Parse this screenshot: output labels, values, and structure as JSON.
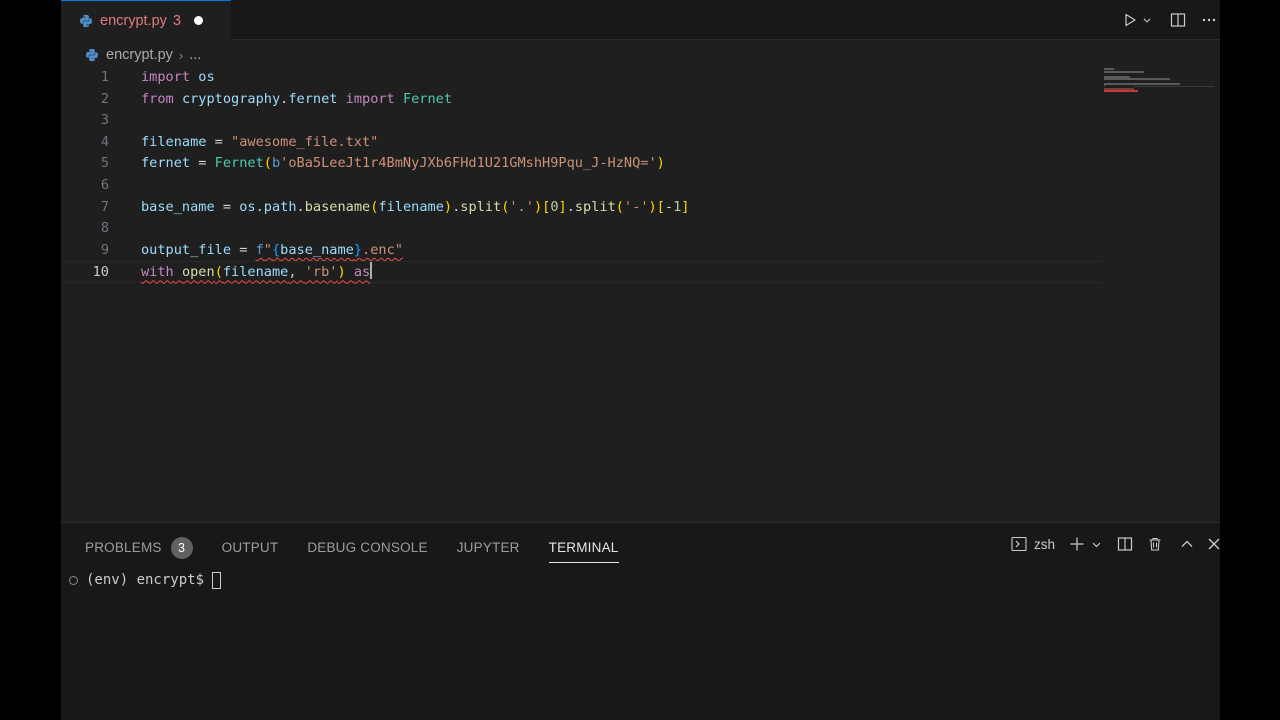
{
  "tab": {
    "filename": "encrypt.py",
    "problem_count": "3",
    "icon": "python-icon"
  },
  "breadcrumb": {
    "file": "encrypt.py",
    "separator": "›",
    "more": "..."
  },
  "editor": {
    "current_line": 10,
    "lines": [
      {
        "n": "1",
        "tokens": [
          [
            "kw",
            "import"
          ],
          [
            "op",
            " "
          ],
          [
            "id",
            "os"
          ]
        ]
      },
      {
        "n": "2",
        "tokens": [
          [
            "kw",
            "from"
          ],
          [
            "op",
            " "
          ],
          [
            "id",
            "cryptography"
          ],
          [
            "op",
            "."
          ],
          [
            "id",
            "fernet"
          ],
          [
            "op",
            " "
          ],
          [
            "kw",
            "import"
          ],
          [
            "op",
            " "
          ],
          [
            "cls",
            "Fernet"
          ]
        ]
      },
      {
        "n": "3",
        "tokens": []
      },
      {
        "n": "4",
        "tokens": [
          [
            "id",
            "filename"
          ],
          [
            "op",
            " = "
          ],
          [
            "str",
            "\"awesome_file.txt\""
          ]
        ]
      },
      {
        "n": "5",
        "tokens": [
          [
            "id",
            "fernet"
          ],
          [
            "op",
            " = "
          ],
          [
            "cls",
            "Fernet"
          ],
          [
            "br1",
            "("
          ],
          [
            "fpre",
            "b"
          ],
          [
            "str",
            "'oBa5LeeJt1r4BmNyJXb6FHd1U21GMshH9Pqu_J-HzNQ='"
          ],
          [
            "br1",
            ")"
          ]
        ]
      },
      {
        "n": "6",
        "tokens": []
      },
      {
        "n": "7",
        "tokens": [
          [
            "id",
            "base_name"
          ],
          [
            "op",
            " = "
          ],
          [
            "id",
            "os"
          ],
          [
            "op",
            "."
          ],
          [
            "id",
            "path"
          ],
          [
            "op",
            "."
          ],
          [
            "fn",
            "basename"
          ],
          [
            "br1",
            "("
          ],
          [
            "id",
            "filename"
          ],
          [
            "br1",
            ")"
          ],
          [
            "op",
            "."
          ],
          [
            "fn",
            "split"
          ],
          [
            "br1",
            "("
          ],
          [
            "str",
            "'.'"
          ],
          [
            "br1",
            ")"
          ],
          [
            "br1",
            "["
          ],
          [
            "num",
            "0"
          ],
          [
            "br1",
            "]"
          ],
          [
            "op",
            "."
          ],
          [
            "fn",
            "split"
          ],
          [
            "br1",
            "("
          ],
          [
            "str",
            "'-'"
          ],
          [
            "br1",
            ")"
          ],
          [
            "br1",
            "["
          ],
          [
            "op",
            "-"
          ],
          [
            "num",
            "1"
          ],
          [
            "br1",
            "]"
          ]
        ]
      },
      {
        "n": "8",
        "tokens": []
      },
      {
        "n": "9",
        "tokens": [
          [
            "id",
            "output_file"
          ],
          [
            "op",
            " = "
          ],
          [
            "fpre sq",
            "f"
          ],
          [
            "str sq",
            "\""
          ],
          [
            "br3 sq",
            "{"
          ],
          [
            "id sq",
            "base_name"
          ],
          [
            "br3 sq",
            "}"
          ],
          [
            "str sq",
            ".enc\""
          ]
        ]
      },
      {
        "n": "10",
        "tokens": [
          [
            "kw sq",
            "with"
          ],
          [
            "op sq",
            " "
          ],
          [
            "fn sq",
            "open"
          ],
          [
            "br1 sq",
            "("
          ],
          [
            "id sq",
            "filename"
          ],
          [
            "op sq",
            ", "
          ],
          [
            "str sq",
            "'rb'"
          ],
          [
            "br1 sq",
            ")"
          ],
          [
            "op sq",
            " "
          ],
          [
            "kw sq",
            "as"
          ]
        ]
      }
    ]
  },
  "panel": {
    "tabs": [
      {
        "label": "PROBLEMS",
        "active": false,
        "badge": "3"
      },
      {
        "label": "OUTPUT",
        "active": false
      },
      {
        "label": "DEBUG CONSOLE",
        "active": false
      },
      {
        "label": "JUPYTER",
        "active": false
      },
      {
        "label": "TERMINAL",
        "active": true
      }
    ],
    "shell": "zsh"
  },
  "terminal": {
    "prompt": "(env) encrypt$"
  },
  "colors": {
    "accent": "#0078d4",
    "error": "#f14c4c",
    "tab_modified": "#e37b7b"
  }
}
